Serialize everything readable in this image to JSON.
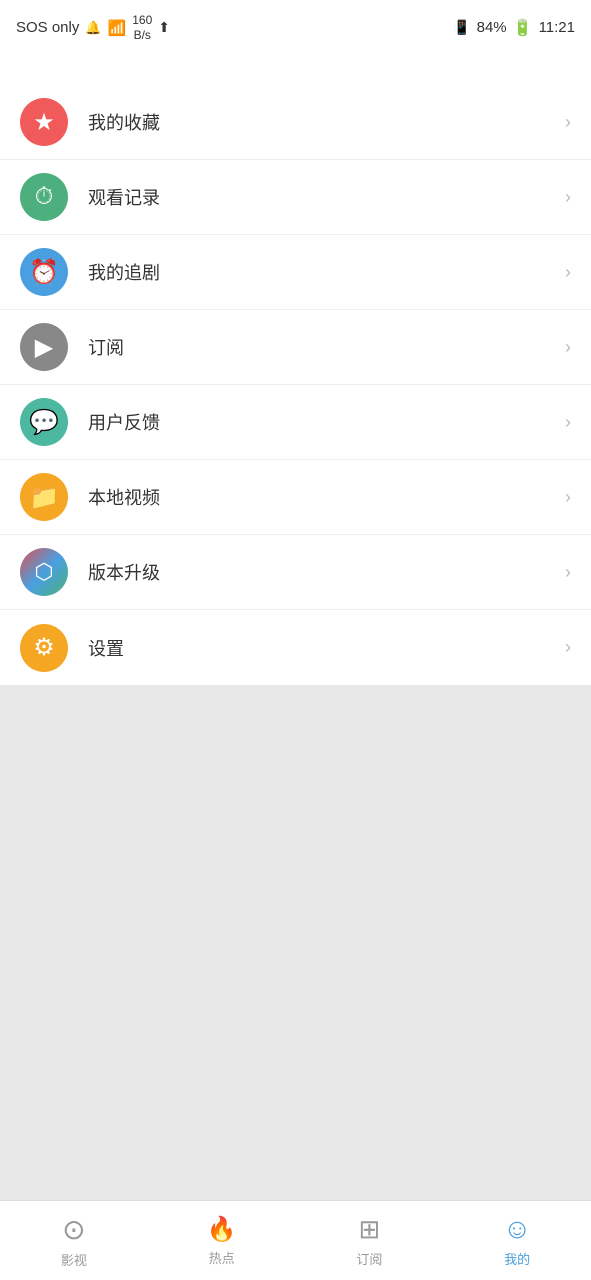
{
  "statusBar": {
    "left": {
      "sos": "SOS only",
      "signal": "🔔",
      "wifi": "WiFi",
      "speed": "160\nB/s",
      "upload": "↑"
    },
    "right": {
      "simIcon": "📶",
      "battery": "84%",
      "batteryIcon": "🔋",
      "time": "11:21"
    }
  },
  "menuItems": [
    {
      "id": "favorites",
      "label": "我的收藏",
      "colorClass": "color-red",
      "iconText": "★"
    },
    {
      "id": "history",
      "label": "观看记录",
      "colorClass": "color-green",
      "iconText": "⏱"
    },
    {
      "id": "following",
      "label": "我的追剧",
      "colorClass": "color-blue",
      "iconText": "⏰"
    },
    {
      "id": "subscribe",
      "label": "订阅",
      "colorClass": "color-gray",
      "iconText": "▶"
    },
    {
      "id": "feedback",
      "label": "用户反馈",
      "colorClass": "color-teal",
      "iconText": "💬"
    },
    {
      "id": "local",
      "label": "本地视频",
      "colorClass": "color-orange",
      "iconText": "📁"
    },
    {
      "id": "update",
      "label": "版本升级",
      "colorClass": "color-multi",
      "iconText": "⬡"
    },
    {
      "id": "settings",
      "label": "设置",
      "colorClass": "color-orange2",
      "iconText": "⚙"
    }
  ],
  "bottomNav": [
    {
      "id": "tv",
      "label": "影视",
      "icon": "⊙",
      "active": false
    },
    {
      "id": "hot",
      "label": "热点",
      "icon": "🔥",
      "active": false
    },
    {
      "id": "subscribe",
      "label": "订阅",
      "icon": "⊞",
      "active": false
    },
    {
      "id": "mine",
      "label": "我的",
      "icon": "☺",
      "active": true
    }
  ]
}
